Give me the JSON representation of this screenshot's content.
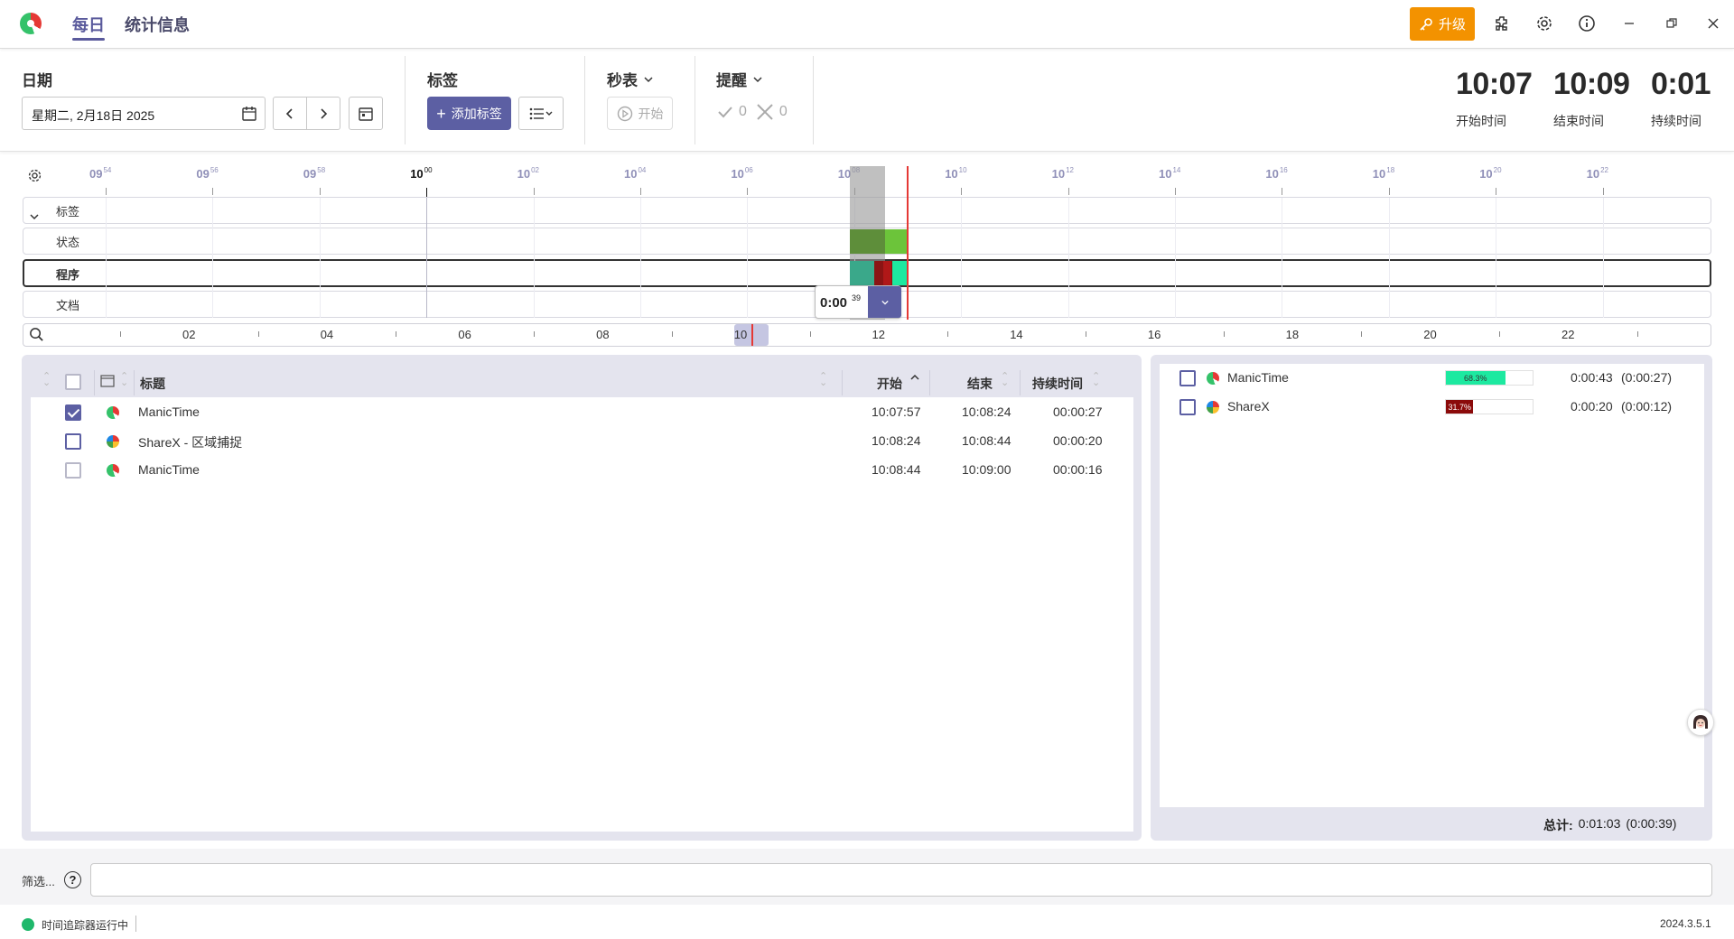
{
  "app": {
    "nav_daily": "每日",
    "nav_stats": "统计信息",
    "upgrade": "升级"
  },
  "toolbar": {
    "date_label": "日期",
    "date_value": "星期二, 2月18日 2025",
    "tags_label": "标签",
    "add_tag": "添加标签",
    "stopwatch_label": "秒表",
    "start_label": "开始",
    "reminder_label": "提醒",
    "reminder_done": "0",
    "reminder_missed": "0",
    "start_time": "10:07",
    "start_time_label": "开始时间",
    "end_time": "10:09",
    "end_time_label": "结束时间",
    "duration": "0:01",
    "duration_label": "持续时间"
  },
  "timeline": {
    "ticks": [
      {
        "h": "09",
        "m": "54"
      },
      {
        "h": "09",
        "m": "56"
      },
      {
        "h": "09",
        "m": "58"
      },
      {
        "h": "10",
        "m": "00"
      },
      {
        "h": "10",
        "m": "02"
      },
      {
        "h": "10",
        "m": "04"
      },
      {
        "h": "10",
        "m": "06"
      },
      {
        "h": "10",
        "m": "08"
      },
      {
        "h": "10",
        "m": "10"
      },
      {
        "h": "10",
        "m": "12"
      },
      {
        "h": "10",
        "m": "14"
      },
      {
        "h": "10",
        "m": "16"
      },
      {
        "h": "10",
        "m": "18"
      },
      {
        "h": "10",
        "m": "20"
      },
      {
        "h": "10",
        "m": "22"
      }
    ],
    "rows": [
      "标签",
      "状态",
      "程序",
      "文档"
    ],
    "popup_time": "0:00",
    "popup_sec": "39",
    "overview_labels": [
      "02",
      "04",
      "06",
      "08",
      "10",
      "12",
      "14",
      "16",
      "18",
      "20",
      "22"
    ]
  },
  "table": {
    "col_title": "标题",
    "col_start": "开始",
    "col_end": "结束",
    "col_duration": "持续时间",
    "rows": [
      {
        "title": "ManicTime",
        "start": "10:07:57",
        "end": "10:08:24",
        "duration": "00:00:27",
        "checked": true,
        "icon": "manictime-icon"
      },
      {
        "title": "ShareX - 区域捕捉",
        "start": "10:08:24",
        "end": "10:08:44",
        "duration": "00:00:20",
        "checked": false,
        "icon": "sharex-icon"
      },
      {
        "title": "ManicTime",
        "start": "10:08:44",
        "end": "10:09:00",
        "duration": "00:00:16",
        "checked": false,
        "icon": "manictime-icon"
      }
    ]
  },
  "summary": {
    "rows": [
      {
        "name": "ManicTime",
        "percent": 68.3,
        "percent_label": "68.3%",
        "total": "0:00:43",
        "active": "(0:00:27)",
        "color": "#1de9a0"
      },
      {
        "name": "ShareX",
        "percent": 31.7,
        "percent_label": "31.7%",
        "total": "0:00:20",
        "active": "(0:00:12)",
        "color": "#8b0a0a"
      }
    ],
    "total_label": "总计:",
    "total_value": "0:01:03",
    "total_active": "(0:00:39)"
  },
  "filter": {
    "label": "筛选..."
  },
  "status": {
    "text": "时间追踪器运行中",
    "version": "2024.3.5.1"
  },
  "colors": {
    "accent": "#5c5fa3",
    "upgrade": "#f39200",
    "status_green": "#1fb86b"
  }
}
